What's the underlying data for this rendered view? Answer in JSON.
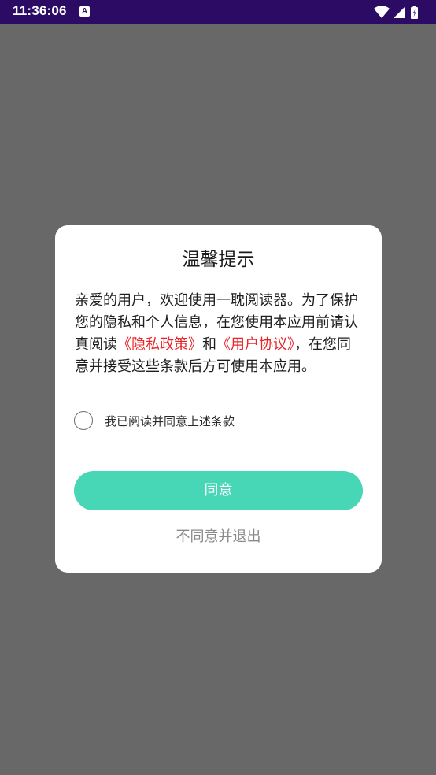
{
  "status_bar": {
    "time": "11:36:06",
    "notification_icon": "A",
    "icons": [
      "wifi-icon",
      "signal-icon",
      "battery-icon"
    ]
  },
  "dialog": {
    "title": "温馨提示",
    "body": {
      "intro": "亲爱的用户，欢迎使用一耽阅读器。为了保护您的隐私和个人信息，在您使用本应用前请认真阅读",
      "privacy_policy": "《隐私政策》",
      "conjunction": "和",
      "user_agreement": "《用户协议》",
      "outro": "，在您同意并接受这些条款后方可使用本应用。"
    },
    "consent_label": "我已阅读并同意上述条款",
    "agree_label": "同意",
    "disagree_label": "不同意并退出"
  },
  "colors": {
    "status_bar": "#2b0b63",
    "scrim": "#686868",
    "accent": "#47d6b6",
    "link": "#e8262a"
  }
}
